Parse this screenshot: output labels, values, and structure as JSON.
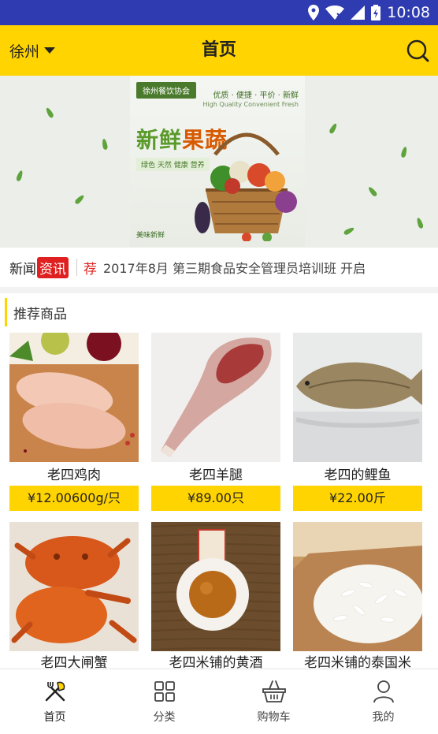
{
  "status_bar": {
    "time": "10:08",
    "icons": [
      "location-icon",
      "wifi-icon",
      "signal-icon",
      "battery-icon"
    ]
  },
  "header": {
    "city": "徐州",
    "title": "首页",
    "search_icon": "search-icon",
    "accent_color": "#ffd400"
  },
  "banner": {
    "logo_text": "徐州餐饮协会",
    "headline_part1": "新鲜",
    "headline_part2": "果蔬",
    "subtitle": "优质 · 便捷 · 平价 · 新鲜",
    "subtitle_en": "High Quality Convenient Fresh",
    "tags": "绿色 天然 健康 营养",
    "stamp": "美味新鲜"
  },
  "news": {
    "label": "新闻",
    "badge": "资讯",
    "tag": "荐",
    "headline": "2017年8月 第三期食品安全管理员培训班 开启"
  },
  "section": {
    "title": "推荐商品"
  },
  "products": [
    {
      "name": "老四鸡肉",
      "price": "¥12.00600g/只"
    },
    {
      "name": "老四羊腿",
      "price": "¥89.00只"
    },
    {
      "name": "老四的鲤鱼",
      "price": "¥22.00斤"
    },
    {
      "name": "老四大闸蟹",
      "price": ""
    },
    {
      "name": "老四米铺的黄酒",
      "price": ""
    },
    {
      "name": "老四米铺的泰国米",
      "price": ""
    }
  ],
  "nav": {
    "items": [
      {
        "label": "首页",
        "icon": "fork-knife-icon",
        "active": true
      },
      {
        "label": "分类",
        "icon": "grid-icon",
        "active": false
      },
      {
        "label": "购物车",
        "icon": "basket-icon",
        "active": false
      },
      {
        "label": "我的",
        "icon": "user-icon",
        "active": false
      }
    ]
  }
}
